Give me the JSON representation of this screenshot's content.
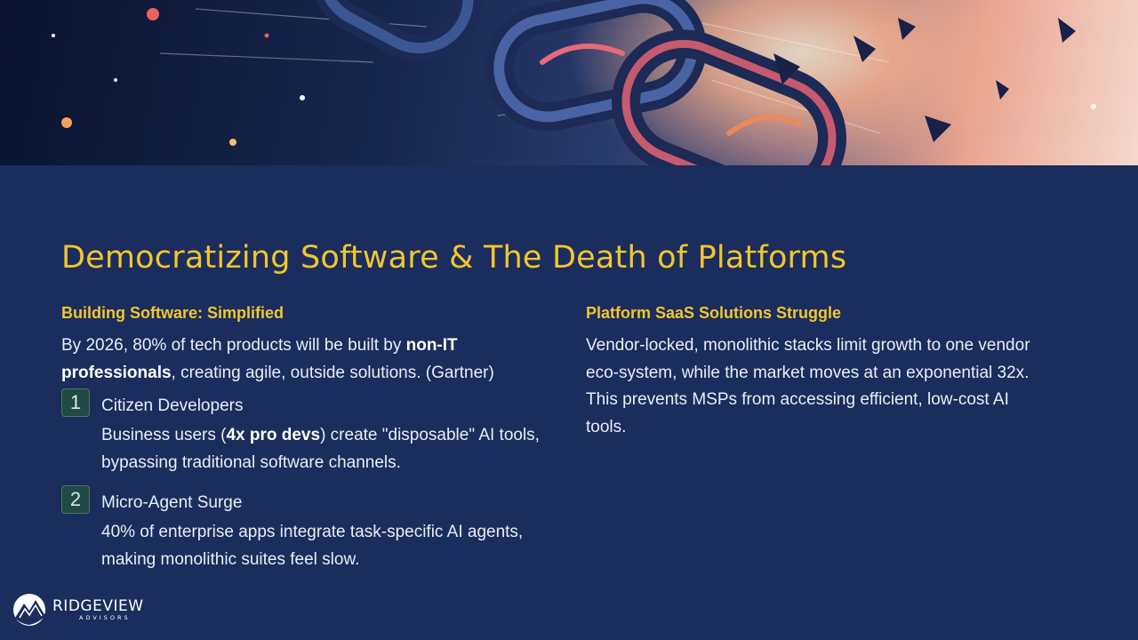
{
  "slide": {
    "title": "Democratizing Software & The Death of Platforms"
  },
  "left": {
    "heading": "Building Software: Simplified",
    "intro": {
      "pre": "By 2026, 80% of tech products will be built by ",
      "bold": "non-IT professionals",
      "post": ", creating agile, outside solutions. (Gartner)"
    },
    "items": [
      {
        "number": "1",
        "title": "Citizen Developers",
        "body_pre": "Business users (",
        "body_bold": "4x pro devs",
        "body_post": ") create \"disposable\" AI tools, bypassing traditional software channels."
      },
      {
        "number": "2",
        "title": "Micro-Agent Surge",
        "body": "40% of enterprise apps integrate task-specific AI agents, making monolithic suites feel slow."
      }
    ]
  },
  "right": {
    "heading": "Platform SaaS Solutions Struggle",
    "body": "Vendor-locked, monolithic stacks limit growth to one vendor eco-system, while the market moves at an exponential 32x. This prevents MSPs from accessing efficient, low-cost AI tools."
  },
  "logo": {
    "name": "RIDGEVIEW",
    "sub": "ADVISORS"
  },
  "colors": {
    "background": "#1b2d5c",
    "accent": "#f2c530",
    "badge_fill": "#1f4a46",
    "text": "#e9edf6"
  },
  "icons": {
    "hero": "breaking-chain-illustration",
    "logo": "ridgeview-logo-icon"
  }
}
